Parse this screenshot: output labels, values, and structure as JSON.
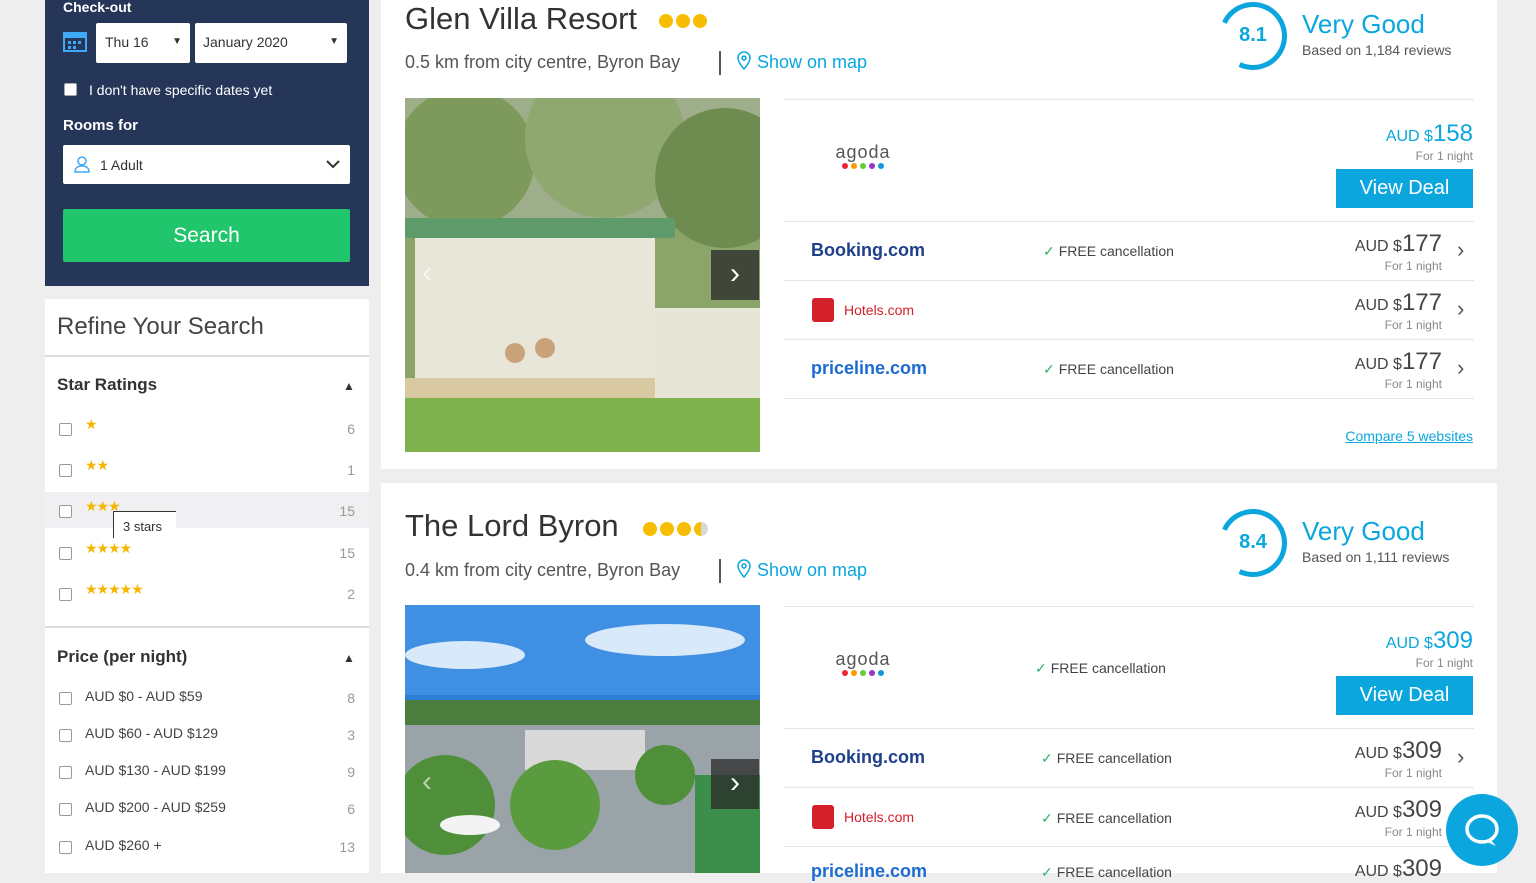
{
  "sidebar": {
    "checkout_label": "Check-out",
    "checkout_day": "Thu 16",
    "checkout_month": "January 2020",
    "no_dates_label": "I don't have specific dates yet",
    "rooms_label": "Rooms for",
    "rooms_value": "1 Adult",
    "search_label": "Search"
  },
  "refine": {
    "title": "Refine Your Search",
    "star_title": "Star Ratings",
    "star_rows": [
      {
        "stars": "★",
        "count": "6"
      },
      {
        "stars": "★★",
        "count": "1"
      },
      {
        "stars": "★★★",
        "count": "15"
      },
      {
        "stars": "★★★★",
        "count": "15"
      },
      {
        "stars": "★★★★★",
        "count": "2"
      }
    ],
    "tooltip": "3 stars",
    "price_title": "Price (per night)",
    "price_rows": [
      {
        "label": "AUD $0 - AUD $59",
        "count": "8"
      },
      {
        "label": "AUD $60 - AUD $129",
        "count": "3"
      },
      {
        "label": "AUD $130 - AUD $199",
        "count": "9"
      },
      {
        "label": "AUD $200 - AUD $259",
        "count": "6"
      },
      {
        "label": "AUD $260 +",
        "count": "13"
      }
    ]
  },
  "hotels": [
    {
      "name": "Glen Villa Resort",
      "distance": "0.5 km from city centre, Byron Bay",
      "show_map": "Show on map",
      "score": "8.1",
      "rating_word": "Very Good",
      "reviews": "Based on 1,184 reviews",
      "deals": [
        {
          "site": "agoda",
          "free": "",
          "cur": "AUD $",
          "amt": "158",
          "per": "For 1 night",
          "cta": "View Deal"
        },
        {
          "site": "Booking.com",
          "free": "FREE cancellation",
          "cur": "AUD $",
          "amt": "177",
          "per": "For 1 night"
        },
        {
          "site": "Hotels.com",
          "free": "",
          "cur": "AUD $",
          "amt": "177",
          "per": "For 1 night"
        },
        {
          "site": "priceline.com",
          "free": "FREE cancellation",
          "cur": "AUD $",
          "amt": "177",
          "per": "For 1 night"
        }
      ],
      "compare": "Compare 5 websites"
    },
    {
      "name": "The Lord Byron",
      "distance": "0.4 km from city centre, Byron Bay",
      "show_map": "Show on map",
      "score": "8.4",
      "rating_word": "Very Good",
      "reviews": "Based on 1,111 reviews",
      "deals": [
        {
          "site": "agoda",
          "free": "FREE cancellation",
          "cur": "AUD $",
          "amt": "309",
          "per": "For 1 night",
          "cta": "View Deal"
        },
        {
          "site": "Booking.com",
          "free": "FREE cancellation",
          "cur": "AUD $",
          "amt": "309",
          "per": "For 1 night"
        },
        {
          "site": "Hotels.com",
          "free": "FREE cancellation",
          "cur": "AUD $",
          "amt": "309",
          "per": "For 1 night"
        },
        {
          "site": "priceline.com",
          "free": "FREE cancellation",
          "cur": "AUD $",
          "amt": "309",
          "per": ""
        }
      ]
    }
  ],
  "colors": {
    "accent": "#0aa6dd",
    "search_green": "#21c56c",
    "sidebar_navy": "#253659",
    "star_gold": "#f7b500"
  }
}
